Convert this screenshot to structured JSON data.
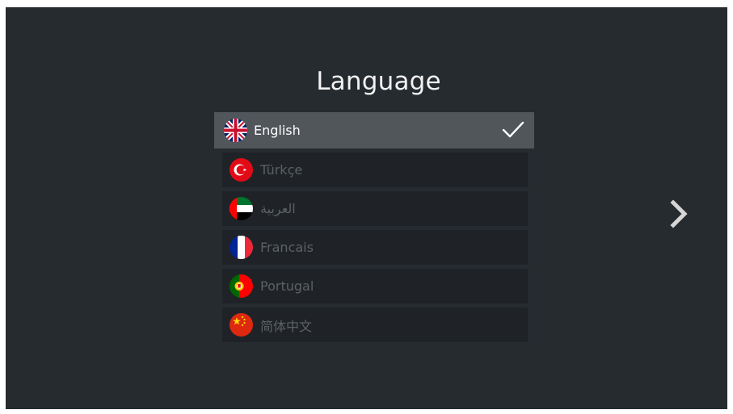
{
  "screen": {
    "title": "Language"
  },
  "languages": [
    {
      "label": "English",
      "flag": "uk-flag-icon",
      "selected": true
    },
    {
      "label": "Türkçe",
      "flag": "turkey-flag-icon",
      "selected": false
    },
    {
      "label": "العربية",
      "flag": "uae-flag-icon",
      "selected": false
    },
    {
      "label": "Francais",
      "flag": "france-flag-icon",
      "selected": false
    },
    {
      "label": "Portugal",
      "flag": "portugal-flag-icon",
      "selected": false
    },
    {
      "label": "简体中文",
      "flag": "china-flag-icon",
      "selected": false
    }
  ],
  "icons": {
    "selected_check": "checkmark-icon",
    "next": "chevron-right-icon"
  },
  "colors": {
    "background": "#262b30",
    "item_background": "#1f2327",
    "selected_background": "#51565b",
    "selected_text": "#ffffff",
    "muted_text": "#5c6166"
  }
}
